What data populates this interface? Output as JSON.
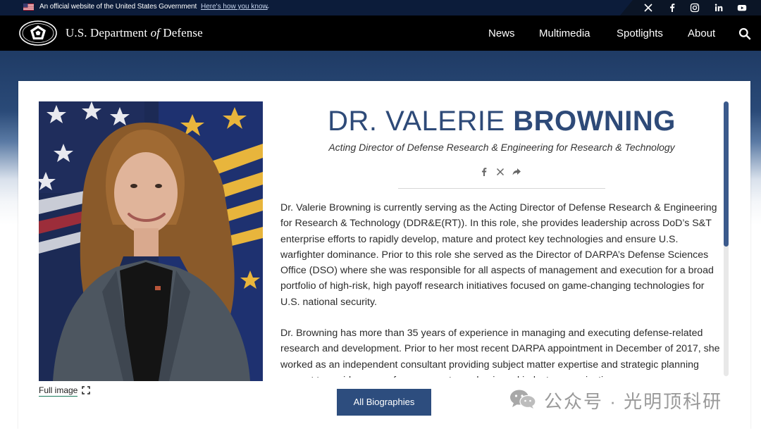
{
  "gov_banner": {
    "official_text": "An official website of the United States Government",
    "how_link": "Here's how you know",
    "chevron": "⌄"
  },
  "social": [
    "x-icon",
    "facebook-icon",
    "instagram-icon",
    "linkedin-icon",
    "youtube-icon"
  ],
  "header": {
    "brand_prefix": "U.S. Department ",
    "brand_of": "of",
    "brand_suffix": " Defense",
    "nav": [
      "News",
      "Multimedia",
      "Spotlights",
      "About"
    ]
  },
  "profile": {
    "first_name": "DR. VALERIE ",
    "last_name": "BROWNING",
    "title": "Acting Director of Defense Research & Engineering for Research & Technology",
    "full_image_label": "Full image"
  },
  "bio": [
    "Dr. Valerie Browning is currently serving as the Acting Director of Defense Research & Engineering for Research & Technology (DDR&E(RT)). In this role, she provides leadership across DoD’s S&T enterprise efforts to rapidly develop, mature and protect key technologies and ensure U.S. warfighter dominance. Prior to this role she served as the Director of DARPA’s Defense Sciences Office (DSO) where she was responsible for all aspects of management and execution for a broad portfolio of high-risk, high payoff research initiatives focused on game-changing technologies for U.S. national security.",
    "Dr. Browning has more than 35 years of experience in managing and executing defense-related research and development. Prior to her most recent DARPA appointment in December of 2017, she worked as an independent consultant providing subject matter expertise and strategic planning support to a wide range of government, academic and industry organizations."
  ],
  "all_biographies_label": "All Biographies",
  "watermark": "公众号 · 光明顶科研",
  "colors": {
    "accent": "#2d4d7e",
    "name": "#2e4a78",
    "header_bg": "#000000"
  }
}
